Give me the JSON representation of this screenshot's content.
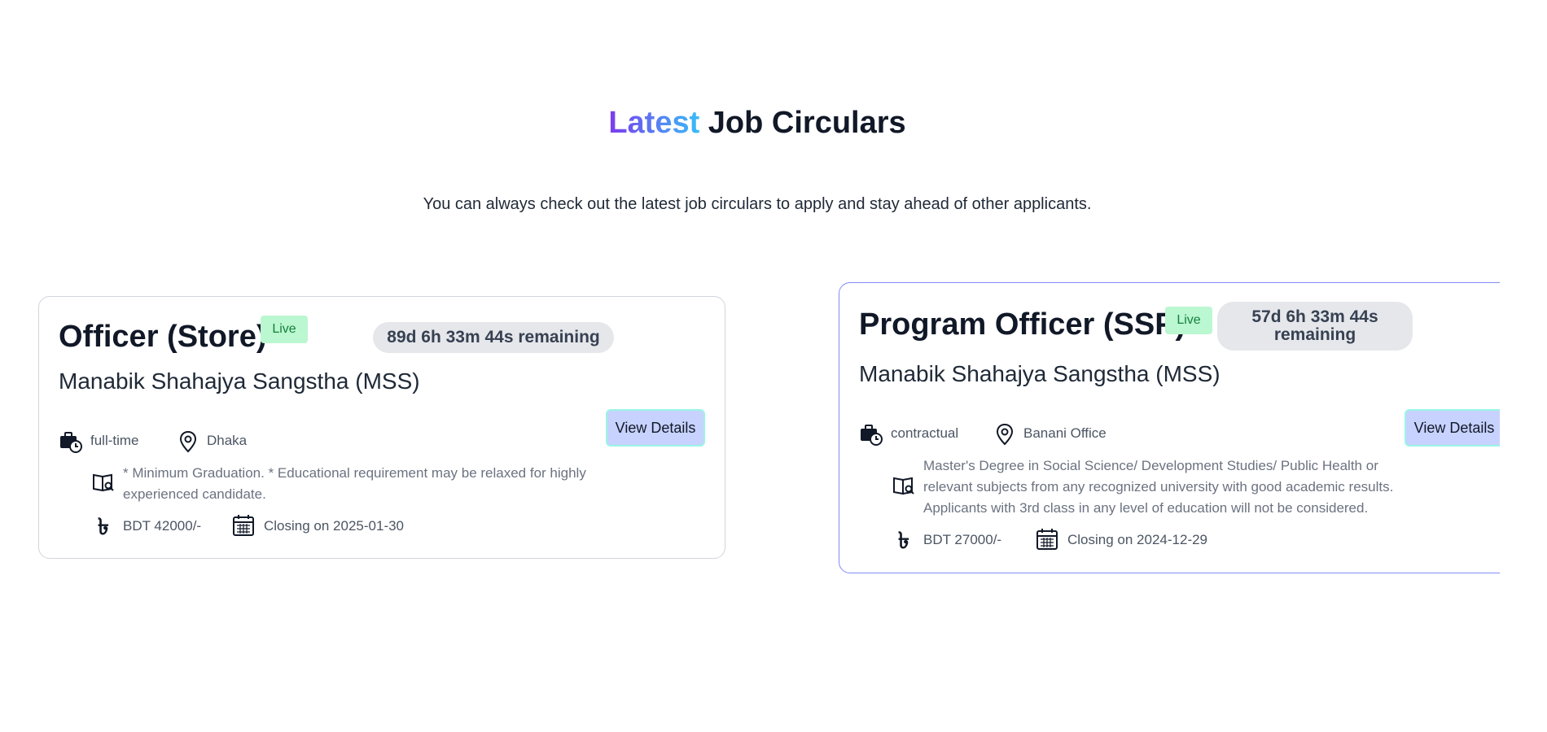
{
  "section": {
    "title_accent": "Latest",
    "title_rest": "Job Circulars",
    "subtitle": "You can always check out the latest job circulars to apply and stay ahead of other applicants."
  },
  "colors": {
    "accent_gradient_start": "#7c3aed",
    "accent_gradient_end": "#38bdf8",
    "live_badge_bg": "#bbf7d0",
    "button_bg": "#c7d2fe",
    "active_card_border": "#818cf8"
  },
  "jobs": [
    {
      "title": "Officer (Store)",
      "status": "Live",
      "remaining": "89d 6h 33m 44s remaining",
      "company": "Manabik Shahajya Sangstha (MSS)",
      "job_type": "full-time",
      "location": "Dhaka",
      "requirement": "* Minimum Graduation. * Educational requirement may be relaxed for highly experienced candidate.",
      "salary": "BDT 42000/-",
      "closing": "Closing on 2025-01-30",
      "button_label": "View Details"
    },
    {
      "title": "Program Officer (SSP)",
      "status": "Live",
      "remaining": "57d 6h 33m 44s remaining",
      "company": "Manabik Shahajya Sangstha (MSS)",
      "job_type": "contractual",
      "location": "Banani Office",
      "requirement": "Master's Degree in Social Science/ Development Studies/ Public Health or relevant subjects from any recognized university with good academic results. Applicants with 3rd class in any level of education will not be considered.",
      "salary": "BDT 27000/-",
      "closing": "Closing on 2024-12-29",
      "button_label": "View Details"
    }
  ],
  "icons": {
    "job_type": "briefcase-clock-icon",
    "location": "map-pin-icon",
    "requirement": "book-icon",
    "salary": "taka-icon",
    "closing": "calendar-icon"
  },
  "taka_symbol": "৳"
}
